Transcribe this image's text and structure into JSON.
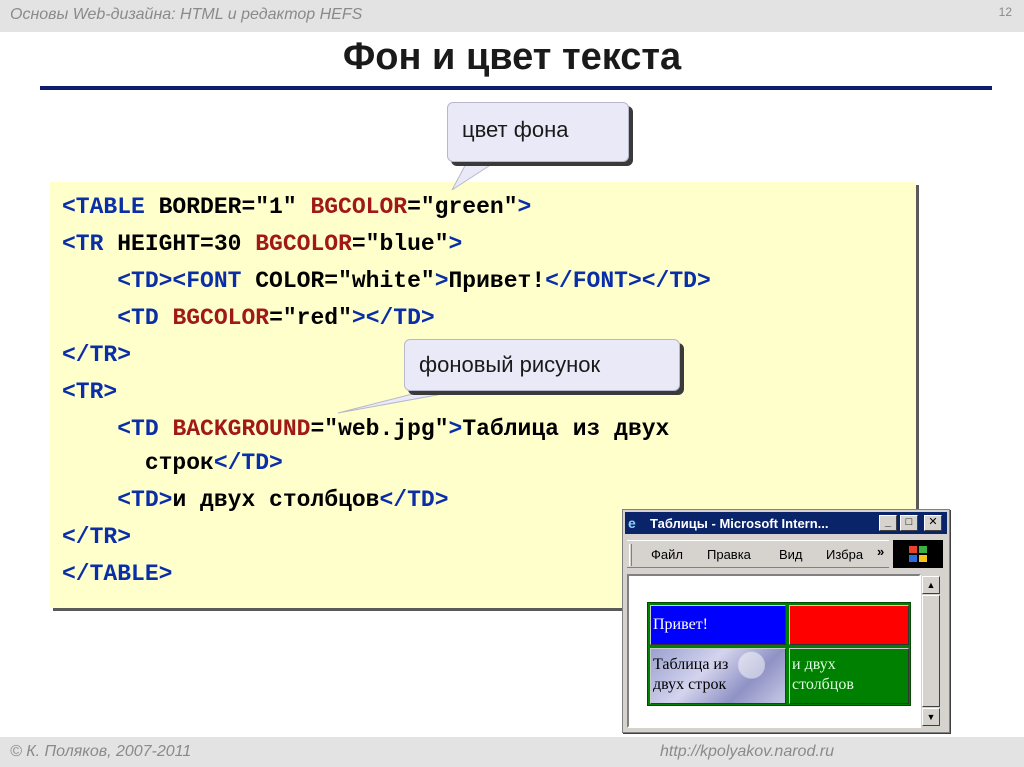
{
  "header": {
    "course": "Основы Web-дизайна: HTML и редактор HEFS",
    "page_number": "12"
  },
  "slide": {
    "title": "Фон и цвет текста"
  },
  "code_lines": [
    [
      [
        "t",
        "<TABLE "
      ],
      [
        "n",
        "BORDER=\"1\" "
      ],
      [
        "a",
        "BGCOLOR"
      ],
      [
        "n",
        "=\"green\""
      ],
      [
        "t",
        ">"
      ]
    ],
    [
      [
        "t",
        "<TR "
      ],
      [
        "n",
        "HEIGHT=30 "
      ],
      [
        "a",
        "BGCOLOR"
      ],
      [
        "n",
        "=\"blue\""
      ],
      [
        "t",
        ">"
      ]
    ],
    [
      [
        "n",
        "    "
      ],
      [
        "t",
        "<TD><FONT "
      ],
      [
        "n",
        "COLOR=\"white\""
      ],
      [
        "t",
        ">"
      ],
      [
        "n",
        "Привет!"
      ],
      [
        "t",
        "</FONT></TD>"
      ]
    ],
    [
      [
        "n",
        "    "
      ],
      [
        "t",
        "<TD "
      ],
      [
        "a",
        "BGCOLOR"
      ],
      [
        "n",
        "=\"red\""
      ],
      [
        "t",
        "></TD>"
      ]
    ],
    [
      [
        "t",
        "</TR>"
      ]
    ],
    [
      [
        "t",
        "<TR>"
      ]
    ],
    [
      [
        "n",
        "    "
      ],
      [
        "t",
        "<TD "
      ],
      [
        "a",
        "BACKGROUND"
      ],
      [
        "n",
        "=\"web.jpg\""
      ],
      [
        "t",
        ">"
      ],
      [
        "n",
        "Таблица из двух"
      ]
    ],
    [
      [
        "n",
        "      строк"
      ],
      [
        "t",
        "</TD>"
      ]
    ],
    [
      [
        "n",
        "    "
      ],
      [
        "t",
        "<TD>"
      ],
      [
        "n",
        "и двух столбцов"
      ],
      [
        "t",
        "</TD>"
      ]
    ],
    [
      [
        "t",
        "</TR>"
      ]
    ],
    [
      [
        "t",
        "</TABLE>"
      ]
    ]
  ],
  "callouts": {
    "bg_color": "цвет фона",
    "bg_image": "фоновый рисунок"
  },
  "browser": {
    "title": "Таблицы - Microsoft Intern...",
    "menu": {
      "file": "Файл",
      "edit": "Правка",
      "view": "Вид",
      "favorites": "Избра",
      "more": "»"
    },
    "demo_table": {
      "cell_1": "Привет!",
      "cell_3_line1": "Таблица из",
      "cell_3_line2": "двух строк",
      "cell_4_line1": "и двух",
      "cell_4_line2": "столбцов"
    }
  },
  "footer": {
    "copyright": "© К. Поляков, 2007-2011",
    "url": "http://kpolyakov.narod.ru"
  },
  "colors": {
    "tag": "#0a2ea8",
    "attribute": "#a01818",
    "code_bg": "#ffffcc",
    "title_rule": "#0f1d6e",
    "green": "#008000",
    "blue": "#0000ff",
    "red": "#ff0000"
  }
}
